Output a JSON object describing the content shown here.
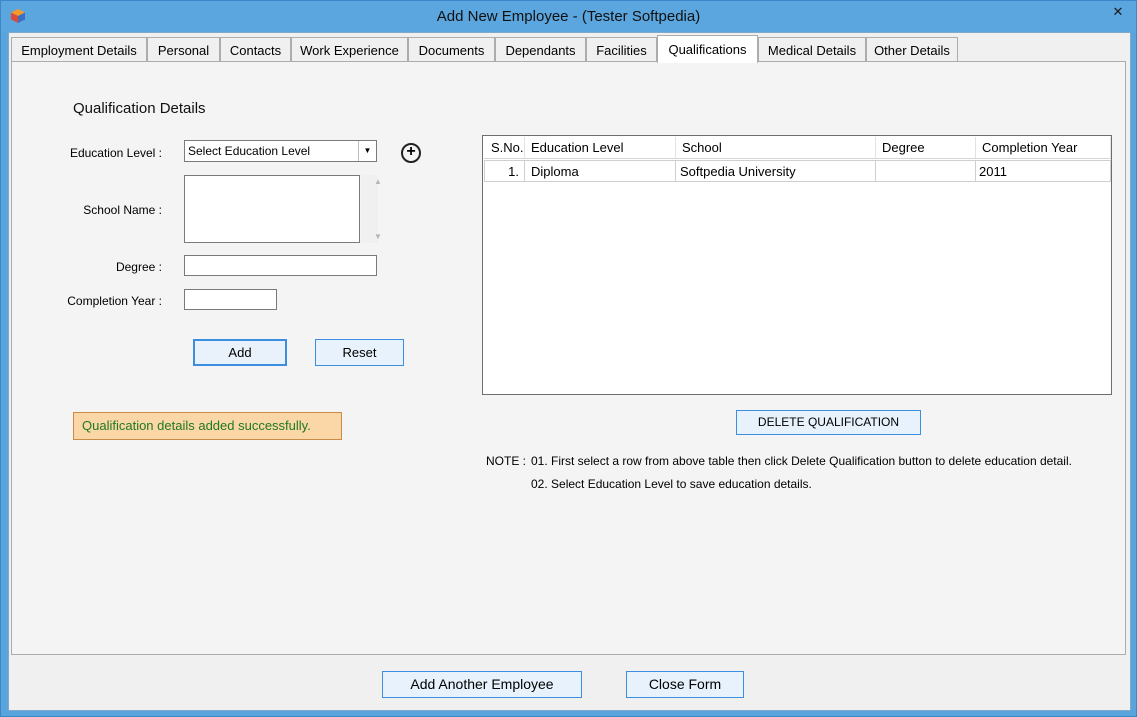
{
  "window": {
    "title": "Add New Employee - (Tester  Softpedia)"
  },
  "tabs": [
    "Employment Details",
    "Personal",
    "Contacts",
    "Work Experience",
    "Documents",
    "Dependants",
    "Facilities",
    "Qualifications",
    "Medical Details",
    "Other Details"
  ],
  "active_tab": "Qualifications",
  "form": {
    "section_title": "Qualification Details",
    "education_level_label": "Education Level :",
    "education_level_value": "Select Education Level",
    "school_name_label": "School Name :",
    "degree_label": "Degree :",
    "completion_year_label": "Completion Year :",
    "add_label": "Add",
    "reset_label": "Reset",
    "success_message": "Qualification details added successfully."
  },
  "grid": {
    "columns": [
      "S.No.",
      "Education Level",
      "School",
      "Degree",
      "Completion Year"
    ],
    "rows": [
      [
        "1.",
        "Diploma",
        "Softpedia University",
        "",
        "2011"
      ]
    ]
  },
  "delete_label": "DELETE QUALIFICATION",
  "notes": {
    "prefix": "NOTE :",
    "line1": "01. First select a row from above table then click Delete Qualification button to delete education detail.",
    "line2": "02. Select Education Level to save education details."
  },
  "footer": {
    "add_another_label": "Add Another Employee",
    "close_label": "Close Form"
  }
}
